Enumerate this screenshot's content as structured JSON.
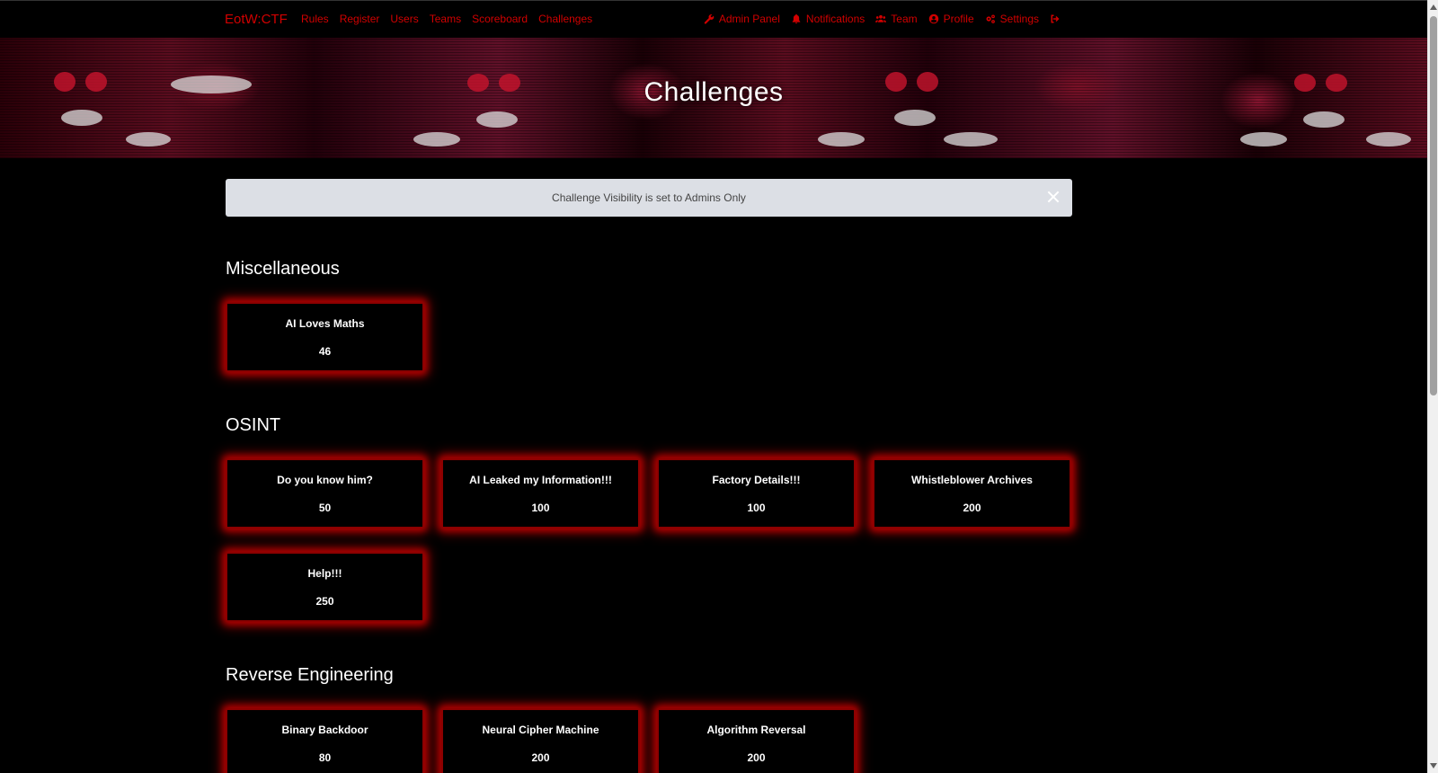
{
  "navbar": {
    "brand": "EotW:CTF",
    "left_links": [
      "Rules",
      "Register",
      "Users",
      "Teams",
      "Scoreboard",
      "Challenges"
    ],
    "right_links": [
      {
        "label": "Admin Panel",
        "icon": "wrench-icon"
      },
      {
        "label": "Notifications",
        "icon": "bell-icon"
      },
      {
        "label": "Team",
        "icon": "users-icon"
      },
      {
        "label": "Profile",
        "icon": "user-circle-icon"
      },
      {
        "label": "Settings",
        "icon": "cogs-icon"
      },
      {
        "label": "",
        "icon": "logout-icon"
      }
    ],
    "link_color": "#d10000"
  },
  "banner": {
    "title": "Challenges"
  },
  "alert": {
    "message": "Challenge Visibility is set to Admins Only"
  },
  "categories": [
    {
      "name": "Miscellaneous",
      "challenges": [
        {
          "name": "AI Loves Maths",
          "value": "46"
        }
      ]
    },
    {
      "name": "OSINT",
      "challenges": [
        {
          "name": "Do you know him?",
          "value": "50"
        },
        {
          "name": "AI Leaked my Information!!!",
          "value": "100"
        },
        {
          "name": "Factory Details!!!",
          "value": "100"
        },
        {
          "name": "Whistleblower Archives",
          "value": "200"
        },
        {
          "name": "Help!!!",
          "value": "250"
        }
      ]
    },
    {
      "name": "Reverse Engineering",
      "challenges": [
        {
          "name": "Binary Backdoor",
          "value": "80"
        },
        {
          "name": "Neural Cipher Machine",
          "value": "200"
        },
        {
          "name": "Algorithm Reversal",
          "value": "200"
        }
      ]
    }
  ],
  "theme": {
    "accent": "#d10000",
    "card_glow": "#b00000",
    "alert_bg": "#dcdfe5"
  }
}
